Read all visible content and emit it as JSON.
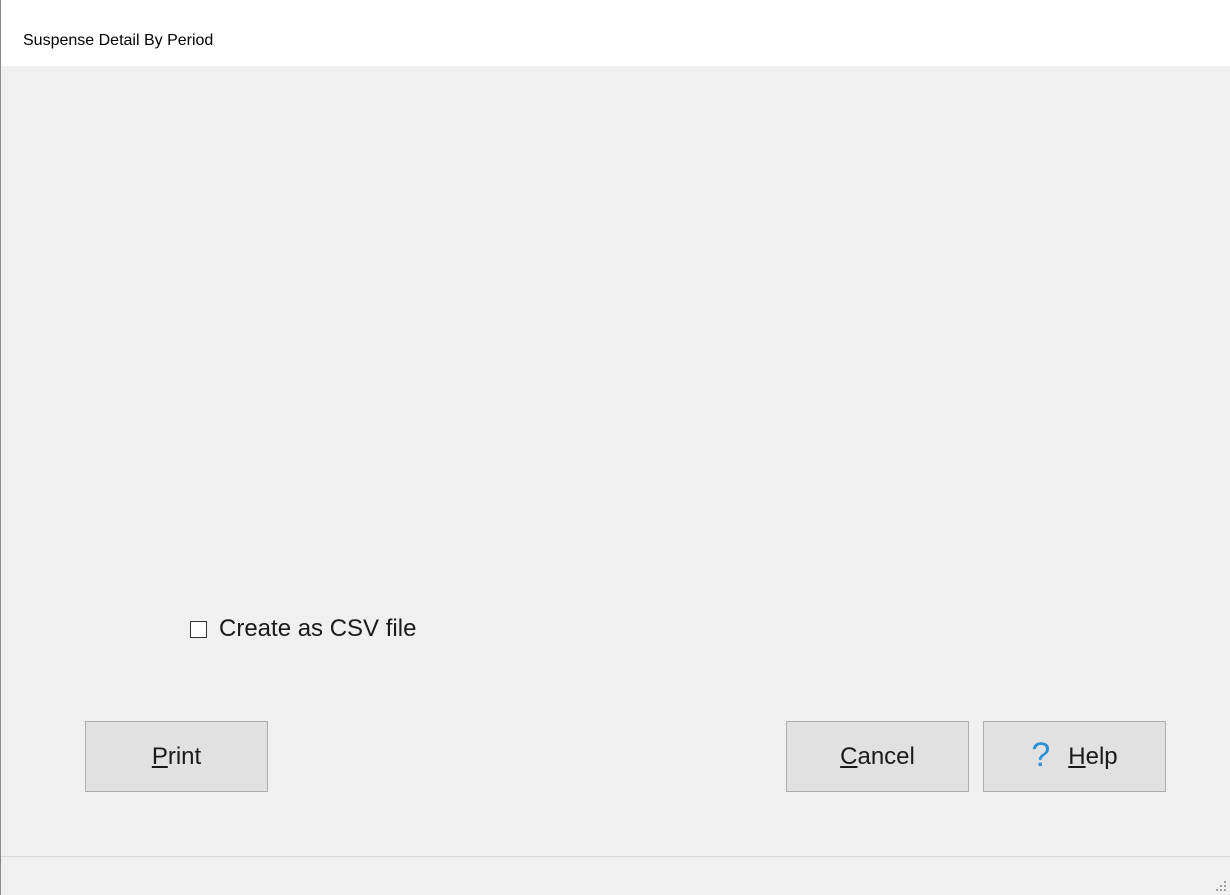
{
  "window": {
    "title": "Suspense Detail By Period"
  },
  "options": {
    "csv_checkbox_label": "Create as CSV file",
    "csv_checked": false
  },
  "buttons": {
    "print": {
      "mnemonic": "P",
      "rest": "rint"
    },
    "cancel": {
      "mnemonic": "C",
      "rest": "ancel"
    },
    "help": {
      "icon_glyph": "?",
      "mnemonic": "H",
      "rest": "elp"
    }
  },
  "colors": {
    "help_icon": "#2a8fd6",
    "client_bg": "#f0f0f0"
  }
}
